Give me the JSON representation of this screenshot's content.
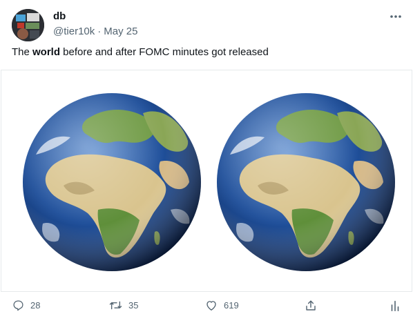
{
  "author": {
    "display_name": "db",
    "handle": "@tier10k",
    "separator": "·",
    "date": "May 25"
  },
  "tweet": {
    "text_before": "The ",
    "text_bold": "world",
    "text_after": " before and after FOMC minutes got released"
  },
  "actions": {
    "reply_count": "28",
    "retweet_count": "35",
    "like_count": "619"
  },
  "icons": {
    "more": "more-horizontal-icon",
    "reply": "reply-icon",
    "retweet": "retweet-icon",
    "like": "heart-icon",
    "share": "share-icon",
    "analytics": "analytics-icon"
  },
  "colors": {
    "text_primary": "#0f1419",
    "text_secondary": "#536471",
    "border": "#e6e9eb",
    "ocean": "#1f4f9a",
    "land_green": "#5f8f3a",
    "land_sand": "#d9c48e"
  }
}
